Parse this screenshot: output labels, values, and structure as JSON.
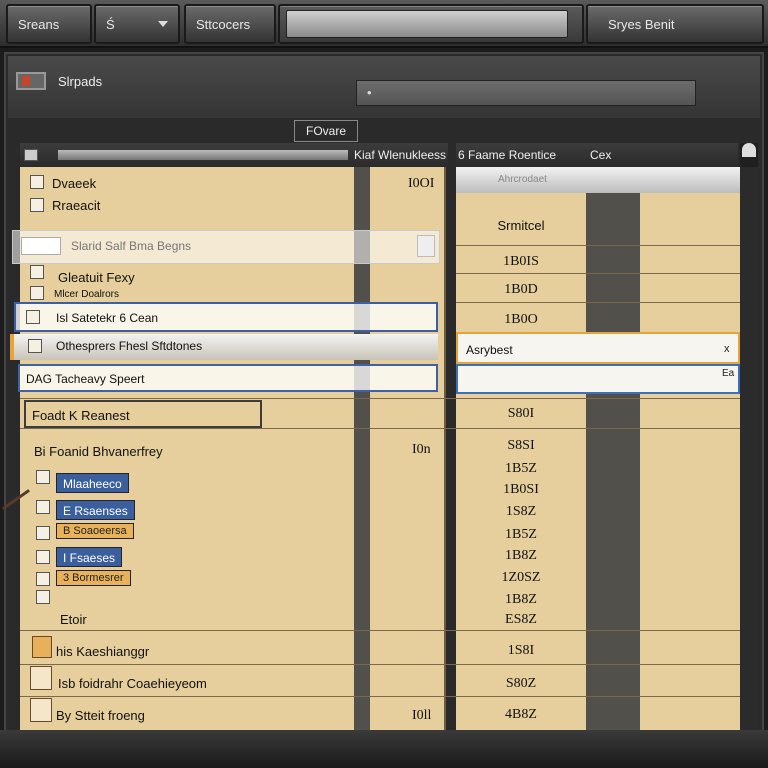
{
  "top_bar": {
    "tab1": "Sreans",
    "tab2": "Ś",
    "tab3": "Sttcocers",
    "tab5": "Sryes Benit"
  },
  "header": {
    "title": "Slrpads",
    "filter_value": "•"
  },
  "view_button": "FOvare",
  "columns": {
    "col2": "Kiaf Wlenukleess",
    "col3": "6 Faame Roentice",
    "col4": "Cex"
  },
  "left_rows": {
    "r1": "Dvaeek",
    "r2": "Rraeacit",
    "r3": "Slarid Salf Bma Begns",
    "r4a": "Gleatuit Fexy",
    "r4b": "Mlcer Doalrors",
    "r5": "Isl Satetekr 6 Cean",
    "r6": "Othesprers Fhesl Sftdtones",
    "r7": "DAG Tacheavy Speert",
    "r8": "Foadt K Reanest",
    "r9": "Bi Foanid Bhvanerfrey",
    "tags": [
      "Mlaaheeco",
      "E Rsaenses",
      "B Soaoeersa",
      "I Fsaeses",
      "3 Bormesrer"
    ],
    "r10": "Etoir",
    "r11": "his Kaeshianggr",
    "r12": "Isb foidrahr Coaehieyeom",
    "r13": "By Stteit froeng"
  },
  "col2_values": {
    "v1": "I0OI",
    "v2": "I0n",
    "v3": "I0ll"
  },
  "col3_values": [
    "Srmitcel",
    "1B0IS",
    "1B0D",
    "1B0O",
    "S80I",
    "S8SI",
    "1B5Z",
    "1B0SI",
    "1S8Z",
    "1B5Z",
    "1B8Z",
    "1Z0SZ",
    "1B8Z",
    "ES8Z",
    "1S8I",
    "S80Z",
    "4B8Z"
  ],
  "col3_header_ghost": "Ahrcrodaet",
  "edit_row": {
    "value": "Asrybest",
    "close": "x",
    "small": "Ea"
  },
  "colors": {
    "grid": "#e6cf9c",
    "accent_blue": "#3a5fa5",
    "tag_orange": "#e8b25b"
  }
}
